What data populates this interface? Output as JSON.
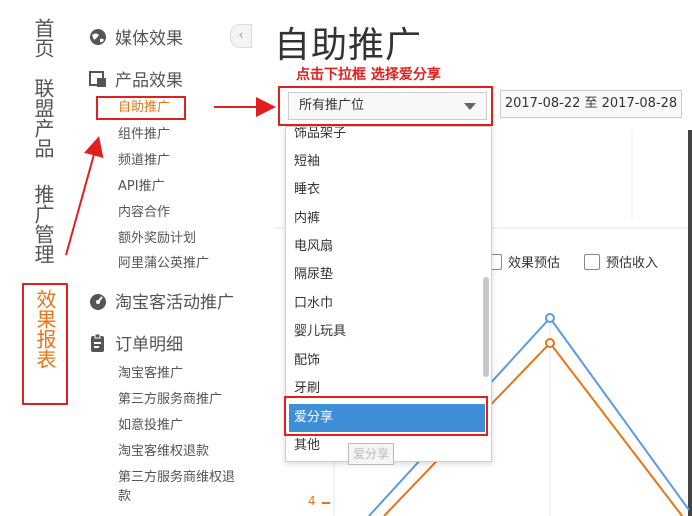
{
  "vnav": {
    "items": [
      {
        "label": "首页"
      },
      {
        "label": "联盟产品"
      },
      {
        "label": "推广管理"
      },
      {
        "label": "效果报表"
      }
    ]
  },
  "subnav": {
    "groups": [
      {
        "label": "媒体效果",
        "icon": "globe-icon"
      },
      {
        "label": "产品效果",
        "icon": "product-icon"
      },
      {
        "label": "淘宝客活动推广",
        "icon": "activity-icon"
      },
      {
        "label": "订单明细",
        "icon": "clipboard-icon"
      }
    ],
    "product_links": [
      "自助推广",
      "组件推广",
      "频道推广",
      "API推广",
      "内容合作",
      "额外奖励计划",
      "阿里蒲公英推广"
    ],
    "order_links": [
      "淘宝客推广",
      "第三方服务商推广",
      "如意投推广",
      "淘宝客维权退款",
      "第三方服务商维权退",
      "款"
    ]
  },
  "collapse_glyph": "‹",
  "main": {
    "title": "自助推广",
    "hint": "点击下拉框 选择爱分享",
    "select_value": "所有推广位",
    "date_range": "2017-08-22 至 2017-08-28",
    "dropdown_options": [
      "饰品架子",
      "短袖",
      "睡衣",
      "内裤",
      "电风扇",
      "隔尿垫",
      "口水巾",
      "婴儿玩具",
      "配饰",
      "牙刷",
      "爱分享",
      "其他"
    ],
    "selected_option": "爱分享",
    "tooltip": "爱分享",
    "checkboxes": [
      "效果预估",
      "预估收入"
    ],
    "axis_tick": "4"
  },
  "colors": {
    "annotation_red": "#e02020",
    "orange": "#e8741a",
    "blue_line": "#5b9be0",
    "selected_bg": "#3f8fd8"
  }
}
